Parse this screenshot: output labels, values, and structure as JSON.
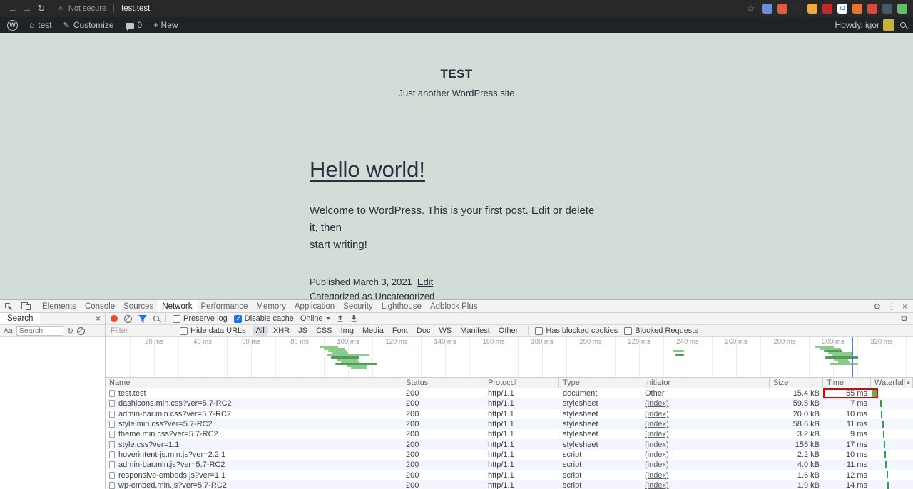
{
  "browser": {
    "security_label": "Not secure",
    "url": "test.test",
    "extensions": [
      {
        "color": "#6a8fd8"
      },
      {
        "color": "#e05d44"
      },
      {
        "color": "#2b2b2b"
      },
      {
        "color": "#f3a73f"
      },
      {
        "color": "#c62828"
      },
      {
        "color": "#ffffff",
        "label": "iD"
      },
      {
        "color": "#e8762c"
      },
      {
        "color": "#d54c3f"
      },
      {
        "color": "#455a64"
      },
      {
        "color": "#66bb6a"
      }
    ]
  },
  "admin_bar": {
    "site_name": "test",
    "customize_label": "Customize",
    "comment_count": "0",
    "new_label": "+ New",
    "howdy": "Howdy, igor"
  },
  "site": {
    "title": "TEST",
    "tagline": "Just another WordPress site",
    "post_title": "Hello world!",
    "body_line1": "Welcome to WordPress. This is your first post. Edit or delete it, then",
    "body_line2": "start writing!",
    "published_label": "Published March 3, 2021",
    "edit_label": "Edit",
    "categorized_label": "Categorized as",
    "category_label": "Uncategorized"
  },
  "devtools": {
    "tabs": [
      "Elements",
      "Console",
      "Sources",
      "Network",
      "Performance",
      "Memory",
      "Application",
      "Security",
      "Lighthouse",
      "Adblock Plus"
    ],
    "selected_tab": "Network",
    "search_panel": {
      "tab_label": "Search",
      "case_sensitive_label": "Aa",
      "placeholder": "Search"
    },
    "network_toolbar": {
      "preserve_log_label": "Preserve log",
      "disable_cache_label": "Disable cache",
      "throttling_value": "Online"
    },
    "filter_bar": {
      "placeholder": "Filter",
      "hide_data_urls_label": "Hide data URLs",
      "filters": [
        "All",
        "XHR",
        "JS",
        "CSS",
        "Img",
        "Media",
        "Font",
        "Doc",
        "WS",
        "Manifest",
        "Other"
      ],
      "selected_filter": "All",
      "has_blocked_cookies_label": "Has blocked cookies",
      "blocked_requests_label": "Blocked Requests"
    },
    "timeline_labels": [
      "20 ms",
      "40 ms",
      "60 ms",
      "80 ms",
      "100 ms",
      "120 ms",
      "140 ms",
      "160 ms",
      "180 ms",
      "200 ms",
      "220 ms",
      "240 ms",
      "260 ms",
      "280 ms",
      "300 ms",
      "320 ms"
    ],
    "table": {
      "columns": [
        "Name",
        "Status",
        "Protocol",
        "Type",
        "Initiator",
        "Size",
        "Time",
        "Waterfall"
      ],
      "rows": [
        {
          "name": "test.test",
          "status": "200",
          "protocol": "http/1.1",
          "type": "document",
          "initiator": "Other",
          "size": "15.4 kB",
          "time": "55 ms",
          "highlight": true
        },
        {
          "name": "dashicons.min.css?ver=5.7-RC2",
          "status": "200",
          "protocol": "http/1.1",
          "type": "stylesheet",
          "initiator": "(index)",
          "size": "59.5 kB",
          "time": "7 ms"
        },
        {
          "name": "admin-bar.min.css?ver=5.7-RC2",
          "status": "200",
          "protocol": "http/1.1",
          "type": "stylesheet",
          "initiator": "(index)",
          "size": "20.0 kB",
          "time": "10 ms"
        },
        {
          "name": "style.min.css?ver=5.7-RC2",
          "status": "200",
          "protocol": "http/1.1",
          "type": "stylesheet",
          "initiator": "(index)",
          "size": "58.6 kB",
          "time": "11 ms"
        },
        {
          "name": "theme.min.css?ver=5.7-RC2",
          "status": "200",
          "protocol": "http/1.1",
          "type": "stylesheet",
          "initiator": "(index)",
          "size": "3.2 kB",
          "time": "9 ms"
        },
        {
          "name": "style.css?ver=1.1",
          "status": "200",
          "protocol": "http/1.1",
          "type": "stylesheet",
          "initiator": "(index)",
          "size": "155 kB",
          "time": "17 ms"
        },
        {
          "name": "hoverintent-js.min.js?ver=2.2.1",
          "status": "200",
          "protocol": "http/1.1",
          "type": "script",
          "initiator": "(index)",
          "size": "2.2 kB",
          "time": "10 ms"
        },
        {
          "name": "admin-bar.min.js?ver=5.7-RC2",
          "status": "200",
          "protocol": "http/1.1",
          "type": "script",
          "initiator": "(index)",
          "size": "4.0 kB",
          "time": "11 ms"
        },
        {
          "name": "responsive-embeds.js?ver=1.1",
          "status": "200",
          "protocol": "http/1.1",
          "type": "script",
          "initiator": "(index)",
          "size": "1.6 kB",
          "time": "12 ms"
        },
        {
          "name": "wp-embed.min.js?ver=5.7-RC2",
          "status": "200",
          "protocol": "http/1.1",
          "type": "script",
          "initiator": "(index)",
          "size": "1.9 kB",
          "time": "14 ms"
        }
      ]
    }
  },
  "colors": {
    "accent_blue": "#1a73e8",
    "record_red": "#ee4b35",
    "highlight_red": "#e60000",
    "wp_bar_bg": "#1d2327",
    "page_bg": "#d2ddd7",
    "waterfall_green": "#2e9e4f"
  }
}
